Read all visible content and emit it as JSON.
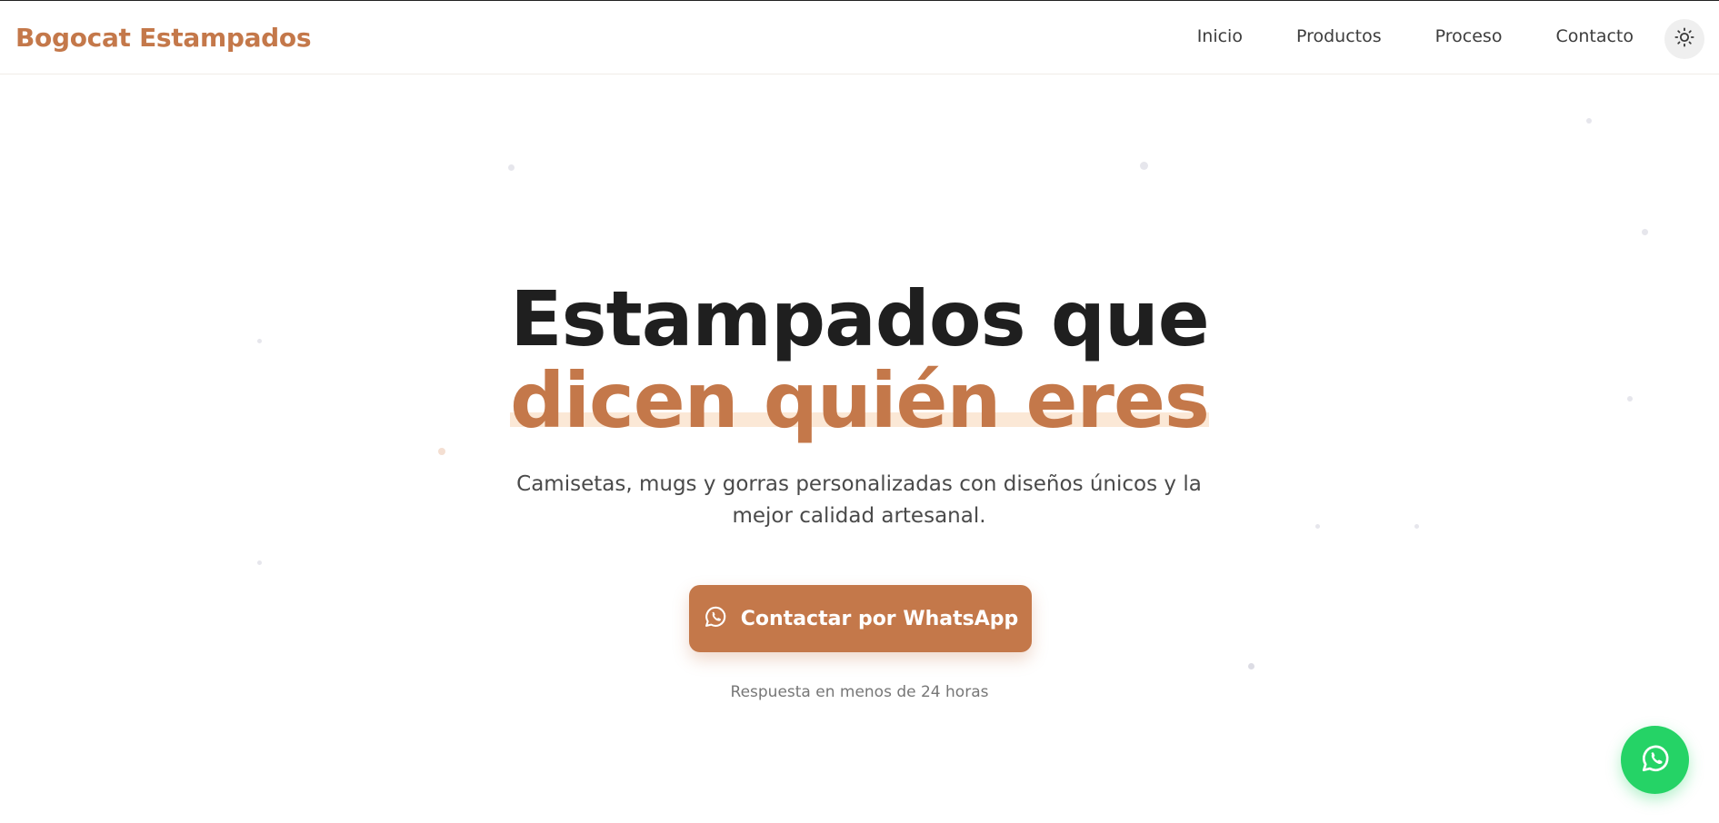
{
  "header": {
    "brand": "Bogocat Estampados",
    "nav": [
      {
        "label": "Inicio"
      },
      {
        "label": "Productos"
      },
      {
        "label": "Proceso"
      },
      {
        "label": "Contacto"
      }
    ],
    "theme_toggle_icon": "sun-icon"
  },
  "hero": {
    "title_line1": "Estampados que",
    "title_line2": "dicen quién eres",
    "subtitle": "Camisetas, mugs y gorras personalizadas con diseños únicos y la mejor calidad artesanal.",
    "cta_label": "Contactar por WhatsApp",
    "cta_icon": "whatsapp-icon",
    "response_note": "Respuesta en menos de 24 horas"
  },
  "floating_button": {
    "icon": "whatsapp-icon"
  },
  "colors": {
    "accent": "#c4784a",
    "heading": "#1f1f1f",
    "whatsapp_green": "#25d366",
    "highlight": "#fbe8d6"
  }
}
